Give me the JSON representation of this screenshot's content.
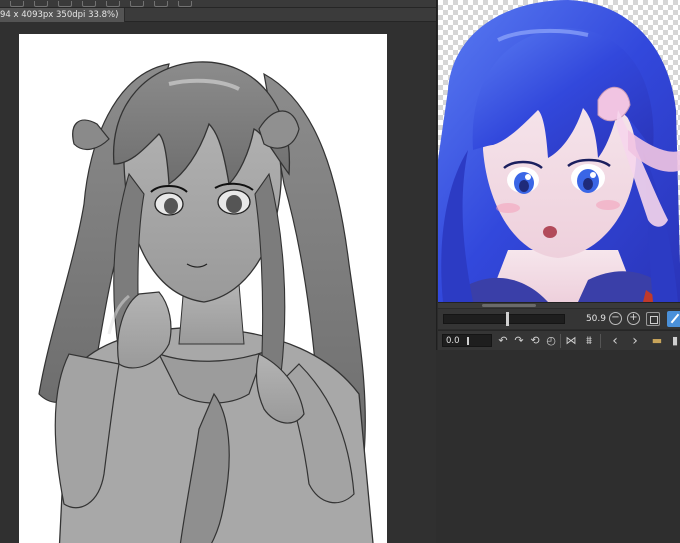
{
  "canvas_tab": {
    "info": "94 x 4093px 350dpi 33.8%)"
  },
  "navigator": {
    "zoom_value": "50.9",
    "zoom_out_symbol": "−",
    "zoom_in_symbol": "+",
    "rotation_value": "0.0"
  },
  "icons": {
    "rotate_left": "↶",
    "rotate_right": "↷",
    "reset_rotation": "⟲",
    "rotate_reset_alt": "◴",
    "flip_horizontal": "⋈",
    "flip_vertical": "⩩",
    "prev": "‹",
    "next": "›",
    "folder": "▬",
    "trash": "▮"
  },
  "colors": {
    "accent": "#4a90d9",
    "ui_dark": "#303030",
    "hair_blue": "#3a4ee0",
    "ribbon_pink": "#f1c4e2"
  }
}
